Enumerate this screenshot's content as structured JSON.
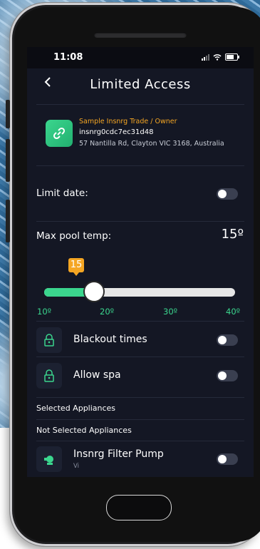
{
  "status_bar": {
    "time": "11:08"
  },
  "header": {
    "title": "Limited Access",
    "back_icon": "chevron-left-icon"
  },
  "account": {
    "owner": "Sample Insnrg Trade / Owner",
    "id": "insnrg0cdc7ec31d48",
    "address": "57 Nantilla Rd, Clayton VIC 3168, Australia",
    "icon": "link-icon"
  },
  "limit_date": {
    "label": "Limit date:",
    "enabled": false
  },
  "max_pool_temp": {
    "label": "Max pool temp:",
    "display": "15º",
    "badge": "15",
    "value": 15,
    "min": 10,
    "max": 40,
    "ticks": [
      "10º",
      "20º",
      "30º",
      "40º"
    ]
  },
  "blackout_times": {
    "label": "Blackout times",
    "enabled": false,
    "icon": "lock-icon"
  },
  "allow_spa": {
    "label": "Allow spa",
    "enabled": false,
    "icon": "lock-icon"
  },
  "sections": {
    "selected": "Selected Appliances",
    "not_selected": "Not Selected Appliances"
  },
  "appliances": [
    {
      "name": "Insnrg Filter Pump",
      "sub": "Vi",
      "enabled": false,
      "icon": "pump-icon"
    }
  ],
  "colors": {
    "accent": "#3bd68e",
    "warning": "#f5a623",
    "background": "#141724"
  }
}
